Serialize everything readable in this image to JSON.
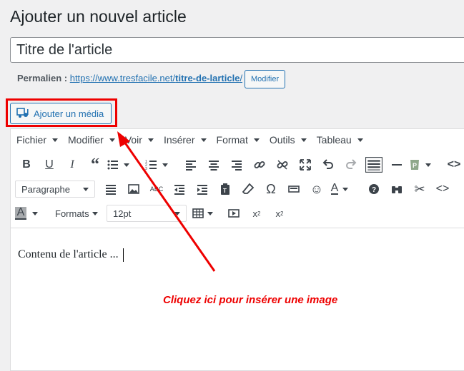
{
  "page": {
    "title": "Ajouter un nouvel article"
  },
  "title_field": {
    "value": "Titre de l'article"
  },
  "permalink": {
    "label": "Permalien :",
    "url_base": "https://www.tresfacile.net/",
    "url_slug": "titre-de-larticle",
    "url_end": "/",
    "edit_label": "Modifier"
  },
  "media_button": {
    "label": "Ajouter un média"
  },
  "menubar": [
    "Fichier",
    "Modifier",
    "Voir",
    "Insérer",
    "Format",
    "Outils",
    "Tableau"
  ],
  "toolbar": {
    "block_format": "Paragraphe",
    "formats_label": "Formats",
    "font_size": "12pt"
  },
  "content": {
    "text": "Contenu de l'article ..."
  },
  "annotation": {
    "text": "Cliquez ici pour insérer une image",
    "color": "#e00000"
  },
  "colors": {
    "accent": "#2271b1",
    "highlight": "#e00000"
  }
}
